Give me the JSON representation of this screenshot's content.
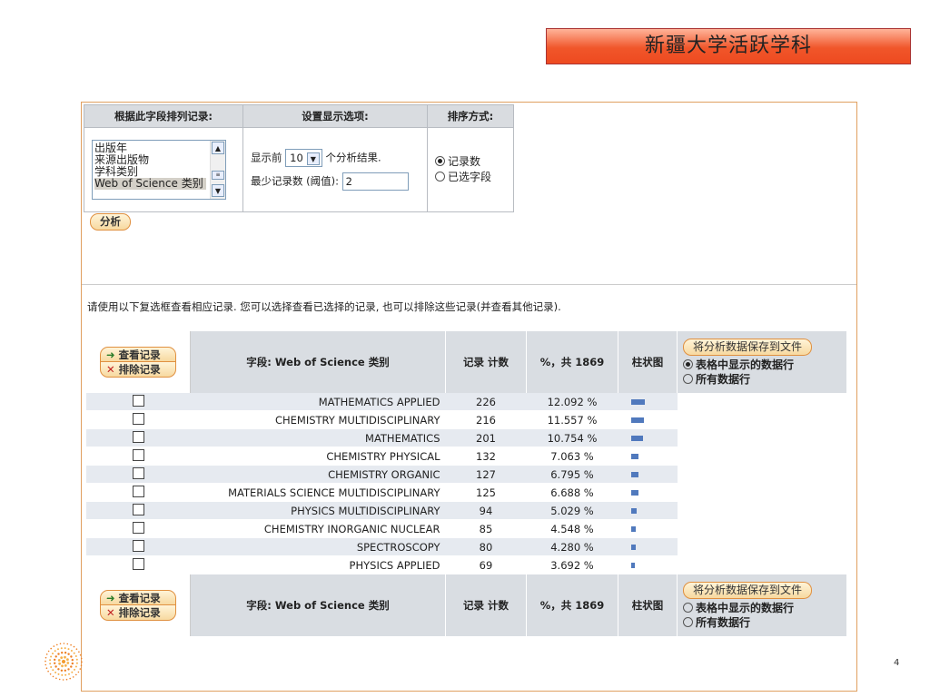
{
  "slide": {
    "title": "新疆大学活跃学科",
    "page_number": "4"
  },
  "options": {
    "col1_header": "根据此字段排列记录:",
    "col2_header": "设置显示选项:",
    "col3_header": "排序方式:",
    "fields": [
      "出版年",
      "来源出版物",
      "学科类别",
      "Web of Science 类别"
    ],
    "show_prefix": "显示前",
    "show_value": "10",
    "show_suffix": "个分析结果.",
    "min_label": "最少记录数 (阈值):",
    "min_value": "2",
    "sort_records": "记录数",
    "sort_field": "已选字段",
    "analyze_button": "分析"
  },
  "hint": "请使用以下复选框查看相应记录. 您可以选择查看已选择的记录, 也可以排除这些记录(并查看其他记录).",
  "results": {
    "view_button": "查看记录",
    "exclude_button": "排除记录",
    "field_header": "字段: Web of Science 类别",
    "count_header": "记录 计数",
    "percent_header": "%，共 1869",
    "bar_header": "柱状图",
    "save_button": "将分析数据保存到文件",
    "save_opt1": "表格中显示的数据行",
    "save_opt2": "所有数据行",
    "rows": [
      {
        "field": "MATHEMATICS APPLIED",
        "count": "226",
        "percent": "12.092 %",
        "bar": 0.12092
      },
      {
        "field": "CHEMISTRY MULTIDISCIPLINARY",
        "count": "216",
        "percent": "11.557 %",
        "bar": 0.11557
      },
      {
        "field": "MATHEMATICS",
        "count": "201",
        "percent": "10.754 %",
        "bar": 0.10754
      },
      {
        "field": "CHEMISTRY PHYSICAL",
        "count": "132",
        "percent": "7.063 %",
        "bar": 0.07063
      },
      {
        "field": "CHEMISTRY ORGANIC",
        "count": "127",
        "percent": "6.795 %",
        "bar": 0.06795
      },
      {
        "field": "MATERIALS SCIENCE MULTIDISCIPLINARY",
        "count": "125",
        "percent": "6.688 %",
        "bar": 0.06688
      },
      {
        "field": "PHYSICS MULTIDISCIPLINARY",
        "count": "94",
        "percent": "5.029 %",
        "bar": 0.05029
      },
      {
        "field": "CHEMISTRY INORGANIC NUCLEAR",
        "count": "85",
        "percent": "4.548 %",
        "bar": 0.04548
      },
      {
        "field": "SPECTROSCOPY",
        "count": "80",
        "percent": "4.280 %",
        "bar": 0.0428
      },
      {
        "field": "PHYSICS APPLIED",
        "count": "69",
        "percent": "3.692 %",
        "bar": 0.03692
      }
    ]
  }
}
